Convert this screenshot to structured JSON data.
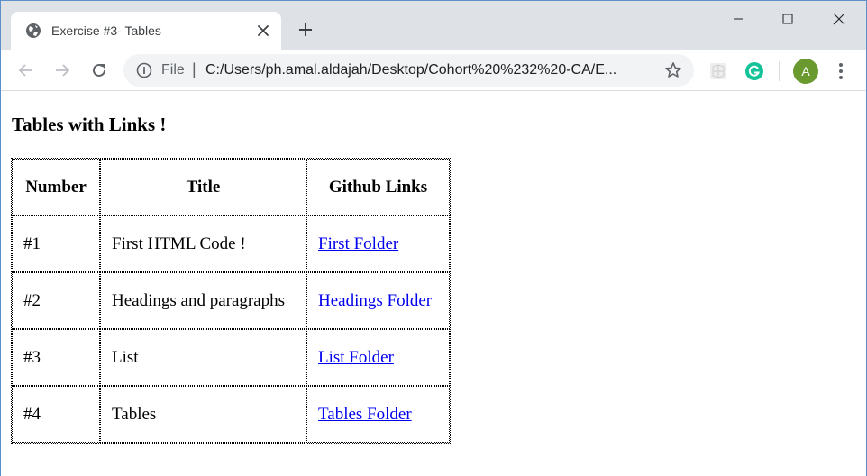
{
  "browser": {
    "tab": {
      "title": "Exercise #3- Tables"
    },
    "address": {
      "scheme_label": "File",
      "separator": "|",
      "url": "C:/Users/ph.amal.aldajah/Desktop/Cohort%20%232%20-CA/E..."
    },
    "profile_initial": "A",
    "icons": {
      "favicon": "globe-icon",
      "close": "close-icon",
      "new_tab": "plus-icon",
      "back": "back-arrow-icon",
      "forward": "forward-arrow-icon",
      "reload": "reload-icon",
      "info": "info-icon",
      "bookmark": "star-icon",
      "menu": "more-vert-icon"
    },
    "colors": {
      "tabstrip": "#dee1e6",
      "omnibox": "#f1f3f4",
      "avatar": "#6a9a2f",
      "grammarly": "#15c39a",
      "link": "#0000ee"
    }
  },
  "page": {
    "heading": "Tables with Links !",
    "table": {
      "headers": [
        "Number",
        "Title",
        "Github Links"
      ],
      "rows": [
        {
          "number": "#1",
          "title": "First HTML Code !",
          "link": "First Folder"
        },
        {
          "number": "#2",
          "title": "Headings and paragraphs",
          "link": "Headings Folder"
        },
        {
          "number": "#3",
          "title": "List",
          "link": "List Folder"
        },
        {
          "number": "#4",
          "title": "Tables",
          "link": "Tables Folder"
        }
      ]
    }
  }
}
